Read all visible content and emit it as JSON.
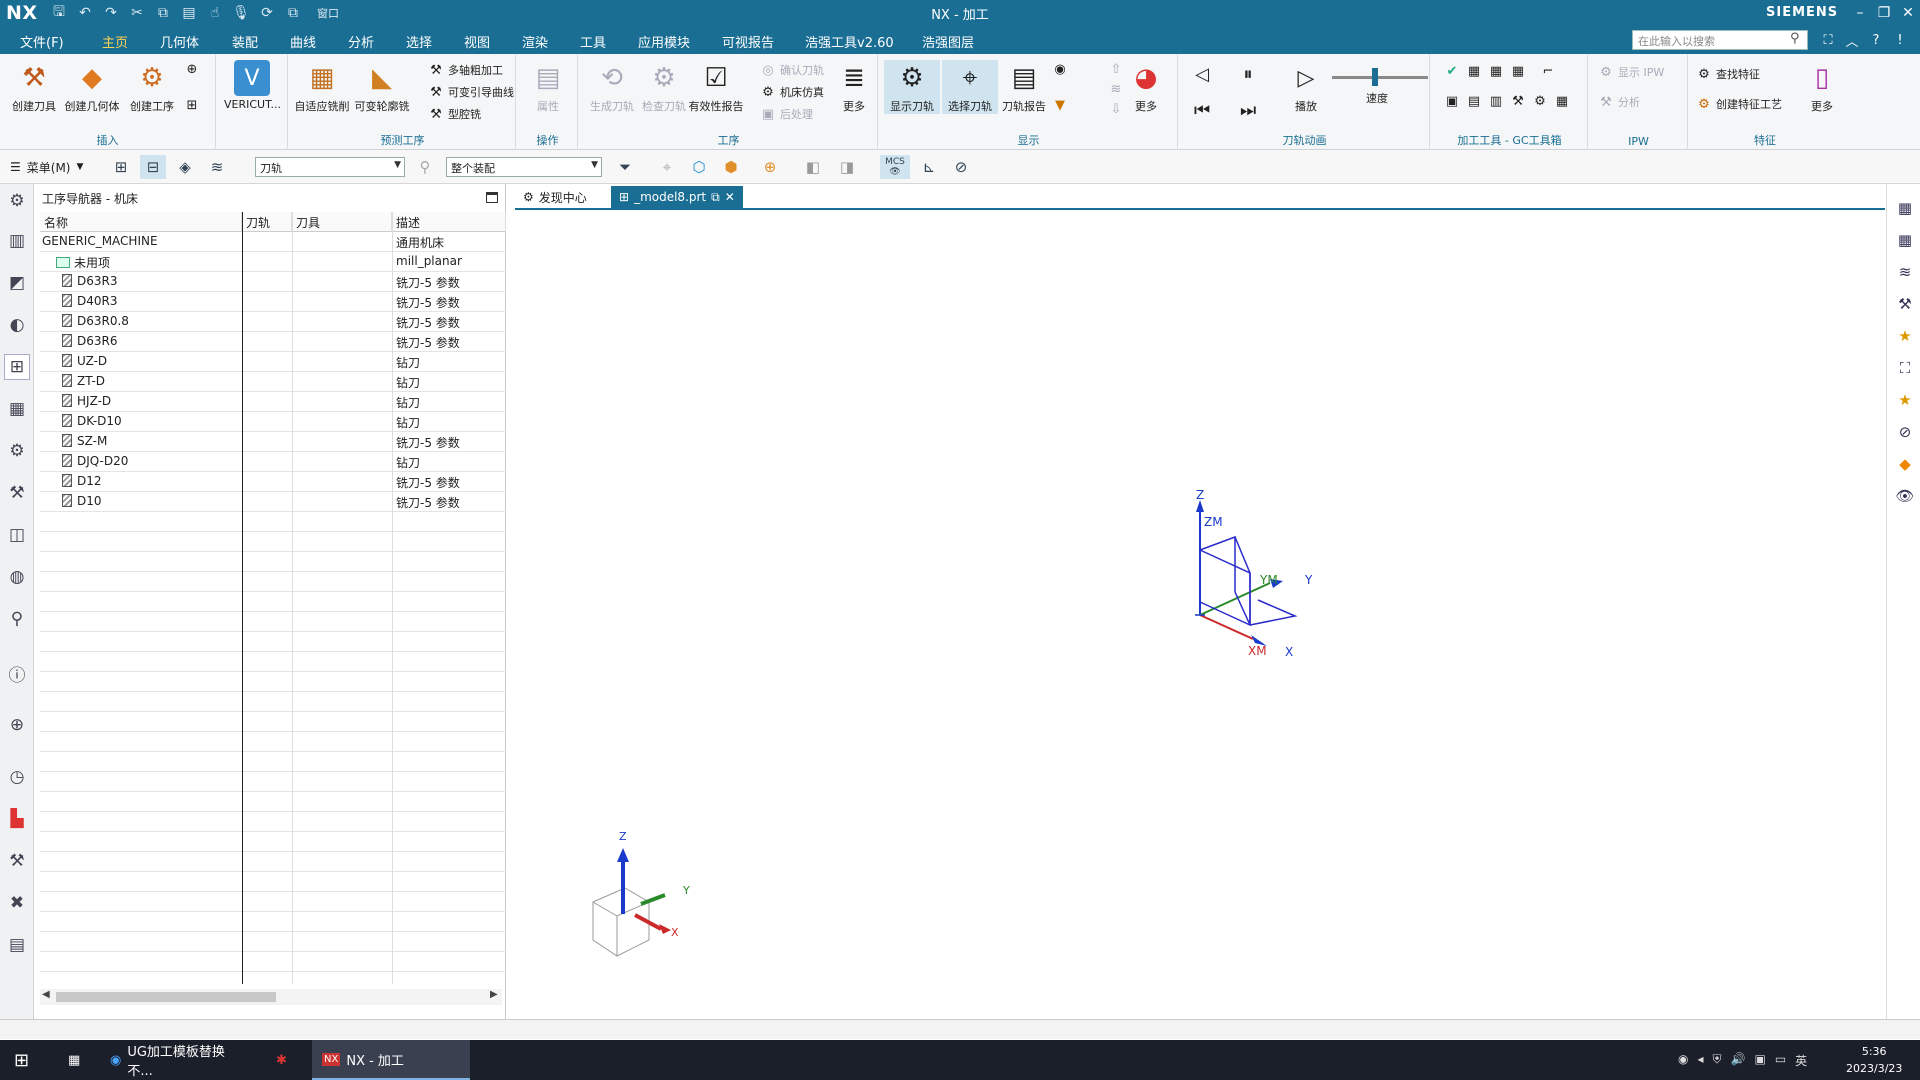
{
  "titlebar": {
    "logo": "NX",
    "title": "NX - 加工",
    "brand": "SIEMENS",
    "window_menu": "窗口"
  },
  "menubar": {
    "items": [
      "文件(F)",
      "主页",
      "几何体",
      "装配",
      "曲线",
      "分析",
      "选择",
      "视图",
      "渲染",
      "工具",
      "应用模块",
      "可视报告",
      "浩强工具v2.60",
      "浩强图层"
    ],
    "active_index": 1,
    "search_placeholder": "在此输入以搜索"
  },
  "ribbon": {
    "insert": {
      "label": "插入",
      "buttons": [
        "创建刀具",
        "创建几何体",
        "创建工序"
      ]
    },
    "vericut": {
      "label": "VERICUT..."
    },
    "predict": {
      "label": "预测工序",
      "buttons": [
        "自适应铣削",
        "可变轮廓铣"
      ],
      "small": [
        "多轴粗加工",
        "可变引导曲线",
        "型腔铣"
      ]
    },
    "ops": {
      "label": "操作",
      "buttons": [
        "属性"
      ]
    },
    "work": {
      "label": "工序",
      "buttons": [
        "生成刀轨",
        "检查刀轨",
        "有效性报告",
        "更多"
      ],
      "small": [
        "确认刀轨",
        "机床仿真",
        "后处理"
      ]
    },
    "display": {
      "label": "显示",
      "buttons": [
        "显示刀轨",
        "选择刀轨",
        "刀轨报告",
        "更多"
      ]
    },
    "anim": {
      "label": "刀轨动画",
      "buttons": [
        "播放"
      ],
      "speed_label": "速度"
    },
    "gc": {
      "label": "加工工具 - GC工具箱"
    },
    "ipw": {
      "label": "IPW",
      "small": [
        "显示 IPW",
        "分析"
      ]
    },
    "feature": {
      "label": "特征",
      "small": [
        "查找特征",
        "创建特征工艺"
      ],
      "more": "更多"
    }
  },
  "toolbar": {
    "menu_label": "菜单(M)",
    "filter_combo": "刀轨",
    "scope_combo": "整个装配",
    "mcs": "MCS"
  },
  "navigator": {
    "title": "工序导航器 - 机床",
    "columns": [
      "名称",
      "刀轨",
      "刀具",
      "描述"
    ],
    "rows": [
      {
        "name": "GENERIC_MACHINE",
        "desc": "通用机床",
        "icon": "none"
      },
      {
        "name": "未用项",
        "desc": "mill_planar",
        "icon": "folder"
      },
      {
        "name": "D63R3",
        "desc": "铣刀-5 参数",
        "icon": "tool"
      },
      {
        "name": "D40R3",
        "desc": "铣刀-5 参数",
        "icon": "tool"
      },
      {
        "name": "D63R0.8",
        "desc": "铣刀-5 参数",
        "icon": "tool"
      },
      {
        "name": "D63R6",
        "desc": "铣刀-5 参数",
        "icon": "tool"
      },
      {
        "name": "UZ-D",
        "desc": "钻刀",
        "icon": "tool"
      },
      {
        "name": "ZT-D",
        "desc": "钻刀",
        "icon": "tool"
      },
      {
        "name": "HJZ-D",
        "desc": "钻刀",
        "icon": "tool"
      },
      {
        "name": "DK-D10",
        "desc": "钻刀",
        "icon": "tool"
      },
      {
        "name": "SZ-M",
        "desc": "铣刀-5 参数",
        "icon": "tool"
      },
      {
        "name": "DJQ-D20",
        "desc": "钻刀",
        "icon": "tool"
      },
      {
        "name": "D12",
        "desc": "铣刀-5 参数",
        "icon": "tool"
      },
      {
        "name": "D10",
        "desc": "铣刀-5 参数",
        "icon": "tool"
      }
    ]
  },
  "tabs": [
    {
      "label": "发现中心"
    },
    {
      "label": "_model8.prt"
    }
  ],
  "viewport": {
    "mcs_labels": [
      "Z",
      "ZM",
      "YM",
      "Y",
      "XM",
      "X"
    ],
    "triad_labels": [
      "Z",
      "Y",
      "X"
    ]
  },
  "taskbar": {
    "tasks": [
      "UG加工模板替换不...",
      "NX - 加工"
    ],
    "time": "5:36",
    "date": "2023/3/23",
    "ime": "英"
  }
}
